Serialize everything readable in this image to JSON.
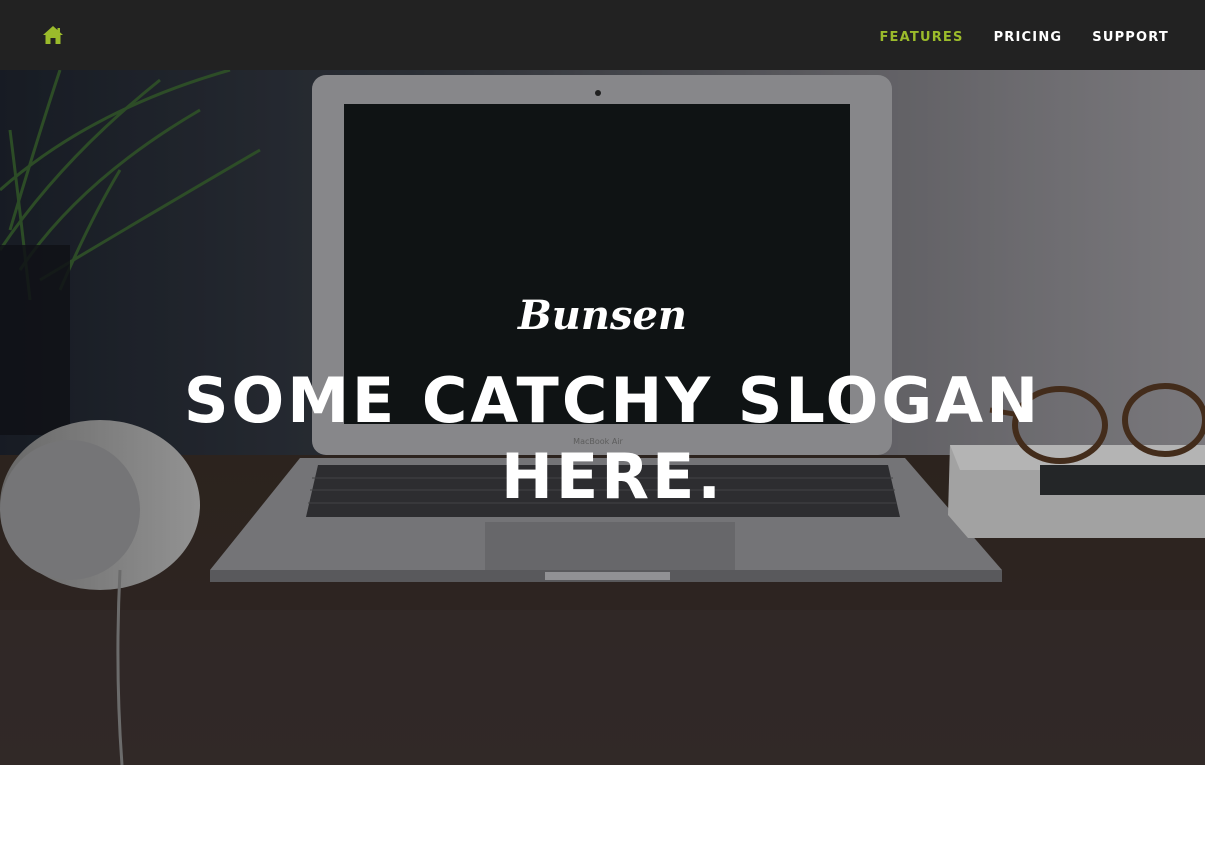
{
  "nav": {
    "home_icon": "home-icon",
    "accent_color": "#9bbb2b",
    "items": [
      {
        "label": "FEATURES",
        "active": true
      },
      {
        "label": "PRICING",
        "active": false
      },
      {
        "label": "SUPPORT",
        "active": false
      }
    ]
  },
  "hero": {
    "brand": "Bunsen",
    "slogan": "SOME CATCHY SLOGAN HERE.",
    "laptop_badge": "MacBook Air"
  }
}
